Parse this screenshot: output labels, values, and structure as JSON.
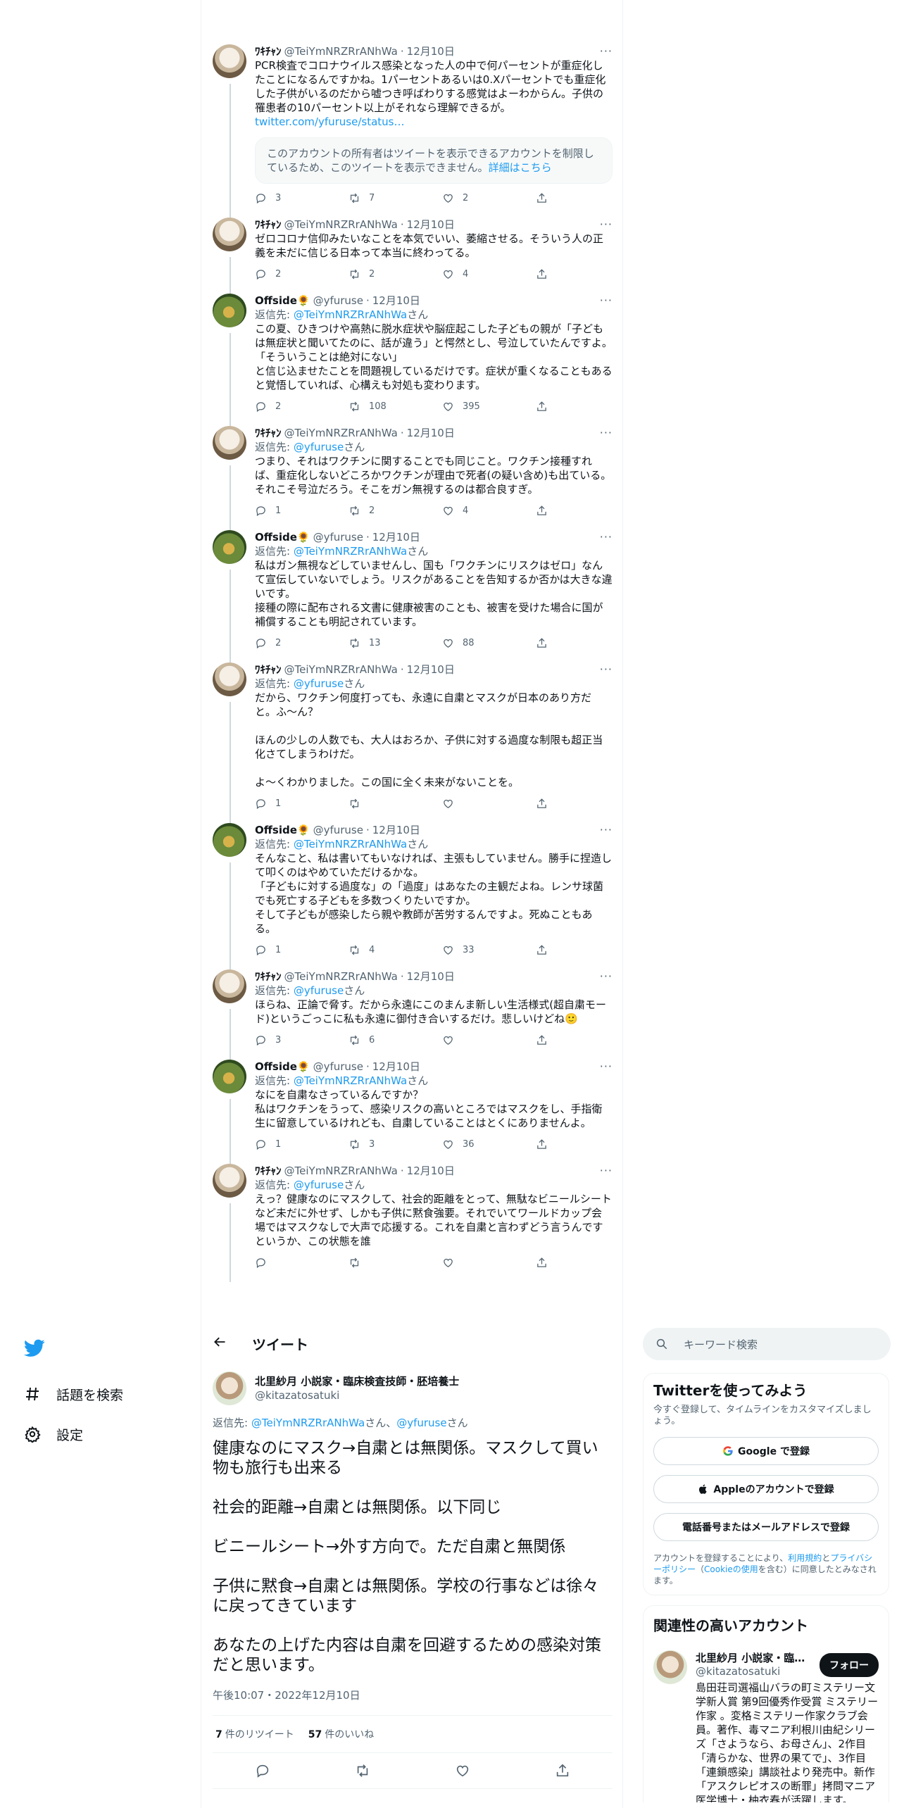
{
  "colors": {
    "link": "#1d9bf0",
    "text": "#0f1419",
    "muted": "#536471",
    "thread": "#cfd9de"
  },
  "nav": {
    "items": [
      {
        "label": "話題を検索",
        "icon": "hashtag-icon"
      },
      {
        "label": "設定",
        "icon": "gear-icon"
      }
    ]
  },
  "feed": [
    {
      "name": "ﾜｷﾁｬﾝ",
      "handle": "@TeiYmNRZRrANhWa",
      "time": "12月10日",
      "text": "PCR検査でコロナウイルス感染となった人の中で何パーセントが重症化したことになるんですかね。1パーセントあるいは0.Xパーセントでも重症化した子供がいるのだから嘘つき呼ばわりする感覚はよーわからん。子供の罹患者の10パーセント以上がそれなら理解できるが。",
      "link": "twitter.com/yfuruse/status…",
      "quote_text": "このアカウントの所有者はツイートを表示できるアカウントを制限しているため、このツイートを表示できません。",
      "quote_link": "詳細はこちら",
      "replies": "3",
      "retweets": "7",
      "likes": "2"
    },
    {
      "name": "ﾜｷﾁｬﾝ",
      "handle": "@TeiYmNRZRrANhWa",
      "time": "12月10日",
      "text": "ゼロコロナ信仰みたいなことを本気でいい、萎縮させる。そういう人の正義を未だに信じる日本って本当に終わってる。",
      "replies": "2",
      "retweets": "2",
      "likes": "4"
    },
    {
      "name": "Offside🌻",
      "handle": "@yfuruse",
      "time": "12月10日",
      "reply_prefix": "返信先: ",
      "reply_to": "@TeiYmNRZRrANhWa",
      "reply_suffix": "さん",
      "text": "この夏、ひきつけや高熱に脱水症状や脳症起こした子どもの親が「子どもは無症状と聞いてたのに、話が違う」と愕然とし、号泣していたんですよ。\n「そういうことは絶対にない」\nと信じ込ませたことを問題視しているだけです。症状が重くなることもあると覚悟していれば、心構えも対処も変わります。",
      "replies": "2",
      "retweets": "108",
      "likes": "395"
    },
    {
      "name": "ﾜｷﾁｬﾝ",
      "handle": "@TeiYmNRZRrANhWa",
      "time": "12月10日",
      "reply_prefix": "返信先: ",
      "reply_to": "@yfuruse",
      "reply_suffix": "さん",
      "text": "つまり、それはワクチンに関することでも同じこと。ワクチン接種すれば、重症化しないどころかワクチンが理由で死者(の疑い含め)も出ている。それこそ号泣だろう。そこをガン無視するのは都合良すぎ。",
      "replies": "1",
      "retweets": "2",
      "likes": "4"
    },
    {
      "name": "Offside🌻",
      "handle": "@yfuruse",
      "time": "12月10日",
      "reply_prefix": "返信先: ",
      "reply_to": "@TeiYmNRZRrANhWa",
      "reply_suffix": "さん",
      "text": "私はガン無視などしていませんし、国も「ワクチンにリスクはゼロ」なんて宣伝していないでしょう。リスクがあることを告知するか否かは大きな違いです。\n接種の際に配布される文書に健康被害のことも、被害を受けた場合に国が補償することも明記されています。",
      "replies": "2",
      "retweets": "13",
      "likes": "88"
    },
    {
      "name": "ﾜｷﾁｬﾝ",
      "handle": "@TeiYmNRZRrANhWa",
      "time": "12月10日",
      "reply_prefix": "返信先: ",
      "reply_to": "@yfuruse",
      "reply_suffix": "さん",
      "text": "だから、ワクチン何度打っても、永遠に自粛とマスクが日本のあり方だと。ふ〜ん？\n\nほんの少しの人数でも、大人はおろか、子供に対する過度な制限も超正当化さてしまうわけだ。\n\nよ〜くわかりました。この国に全く未来がないことを。",
      "replies": "1",
      "retweets": "",
      "likes": ""
    },
    {
      "name": "Offside🌻",
      "handle": "@yfuruse",
      "time": "12月10日",
      "reply_prefix": "返信先: ",
      "reply_to": "@TeiYmNRZRrANhWa",
      "reply_suffix": "さん",
      "text": "そんなこと、私は書いてもいなければ、主張もしていません。勝手に捏造して叩くのはやめていただけるかな。\n「子どもに対する過度な」の「過度」はあなたの主観だよね。レンサ球菌でも死亡する子どもを多数つくりたいですか。\nそして子どもが感染したら親や教師が苦労するんですよ。死ぬこともある。",
      "replies": "1",
      "retweets": "4",
      "likes": "33"
    },
    {
      "name": "ﾜｷﾁｬﾝ",
      "handle": "@TeiYmNRZRrANhWa",
      "time": "12月10日",
      "reply_prefix": "返信先: ",
      "reply_to": "@yfuruse",
      "reply_suffix": "さん",
      "text": "ほらね、正論で脅す。だから永遠にこのまんま新しい生活様式(超自粛モード)というごっこに私も永遠に御付き合いするだけ。悲しいけどね🙂",
      "replies": "3",
      "retweets": "6",
      "likes": ""
    },
    {
      "name": "Offside🌻",
      "handle": "@yfuruse",
      "time": "12月10日",
      "reply_prefix": "返信先: ",
      "reply_to": "@TeiYmNRZRrANhWa",
      "reply_suffix": "さん",
      "text": "なにを自粛なさっているんですか？\n私はワクチンをうって、感染リスクの高いところではマスクをし、手指衛生に留意しているけれども、自粛していることはとくにありませんよ。",
      "replies": "1",
      "retweets": "3",
      "likes": "36"
    },
    {
      "name": "ﾜｷﾁｬﾝ",
      "handle": "@TeiYmNRZRrANhWa",
      "time": "12月10日",
      "reply_prefix": "返信先: ",
      "reply_to": "@yfuruse",
      "reply_suffix": "さん",
      "text": "えっ？健康なのにマスクして、社会的距離をとって、無駄なビニールシートなど未だに外せず、しかも子供に黙食強要。それでいてワールドカップ会場ではマスクなしで大声で応援する。これを自粛と言わずどう言うんですというか、この状態を誰",
      "replies": "",
      "retweets": "",
      "likes": ""
    }
  ],
  "header": {
    "title": "ツイート"
  },
  "main_tweet": {
    "name": "北里紗月 小説家・臨床検査技師・胚培養士",
    "handle": "@kitazatosatuki",
    "reply_prefix": "返信先: ",
    "reply_to_1": "@TeiYmNRZRrANhWa",
    "reply_mid": "さん、",
    "reply_to_2": "@yfuruse",
    "reply_suffix": "さん",
    "text": "健康なのにマスク→自粛とは無関係。マスクして買い物も旅行も出来る\n\n社会的距離→自粛とは無関係。以下同じ\n\nビニールシート→外す方向で。ただ自粛と無関係\n\n子供に黙食→自粛とは無関係。学校の行事などは徐々に戻ってきています\n\nあなたの上げた内容は自粛を回避するための感染対策だと思います。",
    "timestamp": "午後10:07・2022年12月10日",
    "retweets_count": "7",
    "retweets_label": "件のリツイート",
    "likes_count": "57",
    "likes_label": "件のいいね"
  },
  "sidebar": {
    "search_placeholder": "キーワード検索",
    "signup": {
      "title": "Twitterを使ってみよう",
      "subtitle": "今すぐ登録して、タイムラインをカスタマイズしましょう。",
      "google_label": "Google で登録",
      "apple_label": "Appleのアカウントで登録",
      "phone_label": "電話番号またはメールアドレスで登録",
      "terms_prefix": "アカウントを登録することにより、",
      "terms_link": "利用規約",
      "terms_and": "と",
      "privacy_link": "プライバシーポリシー",
      "cookie_pre": "（",
      "cookie_link": "Cookieの使用",
      "terms_suffix": "を含む）に同意したとみなされます。"
    },
    "related": {
      "title": "関連性の高いアカウント",
      "name": "北里紗月 小説家・臨…",
      "handle": "@kitazatosatuki",
      "follow_label": "フォロー",
      "bio": "島田荘司選福山バラの町ミステリー文学新人賞 第9回優秀作受賞 ミステリー作家 。変格ミステリー作家クラブ会員。著作、毒マニア利根川由紀シリーズ「さようなら、お母さん」、2作目「清らかな、世界の果てで」、3作目「連鎖感染」講談社より発売中。新作「アスクレピオスの断罪」拷問マニア医学博士・柚衣春が活躍します。"
    }
  }
}
